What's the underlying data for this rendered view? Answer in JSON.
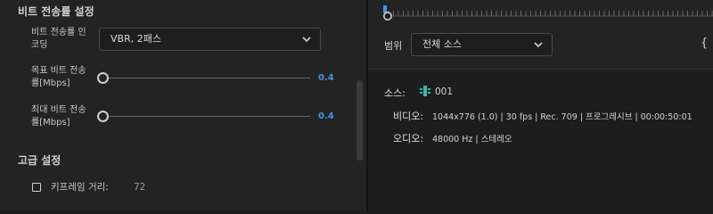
{
  "left": {
    "bitrate_section_title": "비트 전송률 설정",
    "encoding": {
      "label_line1": "비트 전송률 인",
      "label_line2": "코딩",
      "value": "VBR, 2패스"
    },
    "target_bitrate": {
      "label_line1": "목표 비트 전송",
      "label_line2": "률[Mbps]",
      "value": "0.4"
    },
    "max_bitrate": {
      "label_line1": "최대 비트 전송",
      "label_line2": "률[Mbps]",
      "value": "0.4"
    },
    "advanced_section_title": "고급 설정",
    "keyframe": {
      "label": "키프레임 거리:",
      "value": "72",
      "checked": false
    }
  },
  "right": {
    "range_label": "범위",
    "range_value": "전체 소스",
    "source": {
      "key": "소스:",
      "name": "001"
    },
    "video": {
      "key": "비디오:",
      "value": "1044x776 (1.0) | 30 fps | Rec. 709 | 프로그레시브 | 00:00:50:01"
    },
    "audio": {
      "key": "오디오:",
      "value": "48000 Hz | 스테레오"
    },
    "more_glyph": "{",
    "accent_color": "#4a90e2"
  }
}
